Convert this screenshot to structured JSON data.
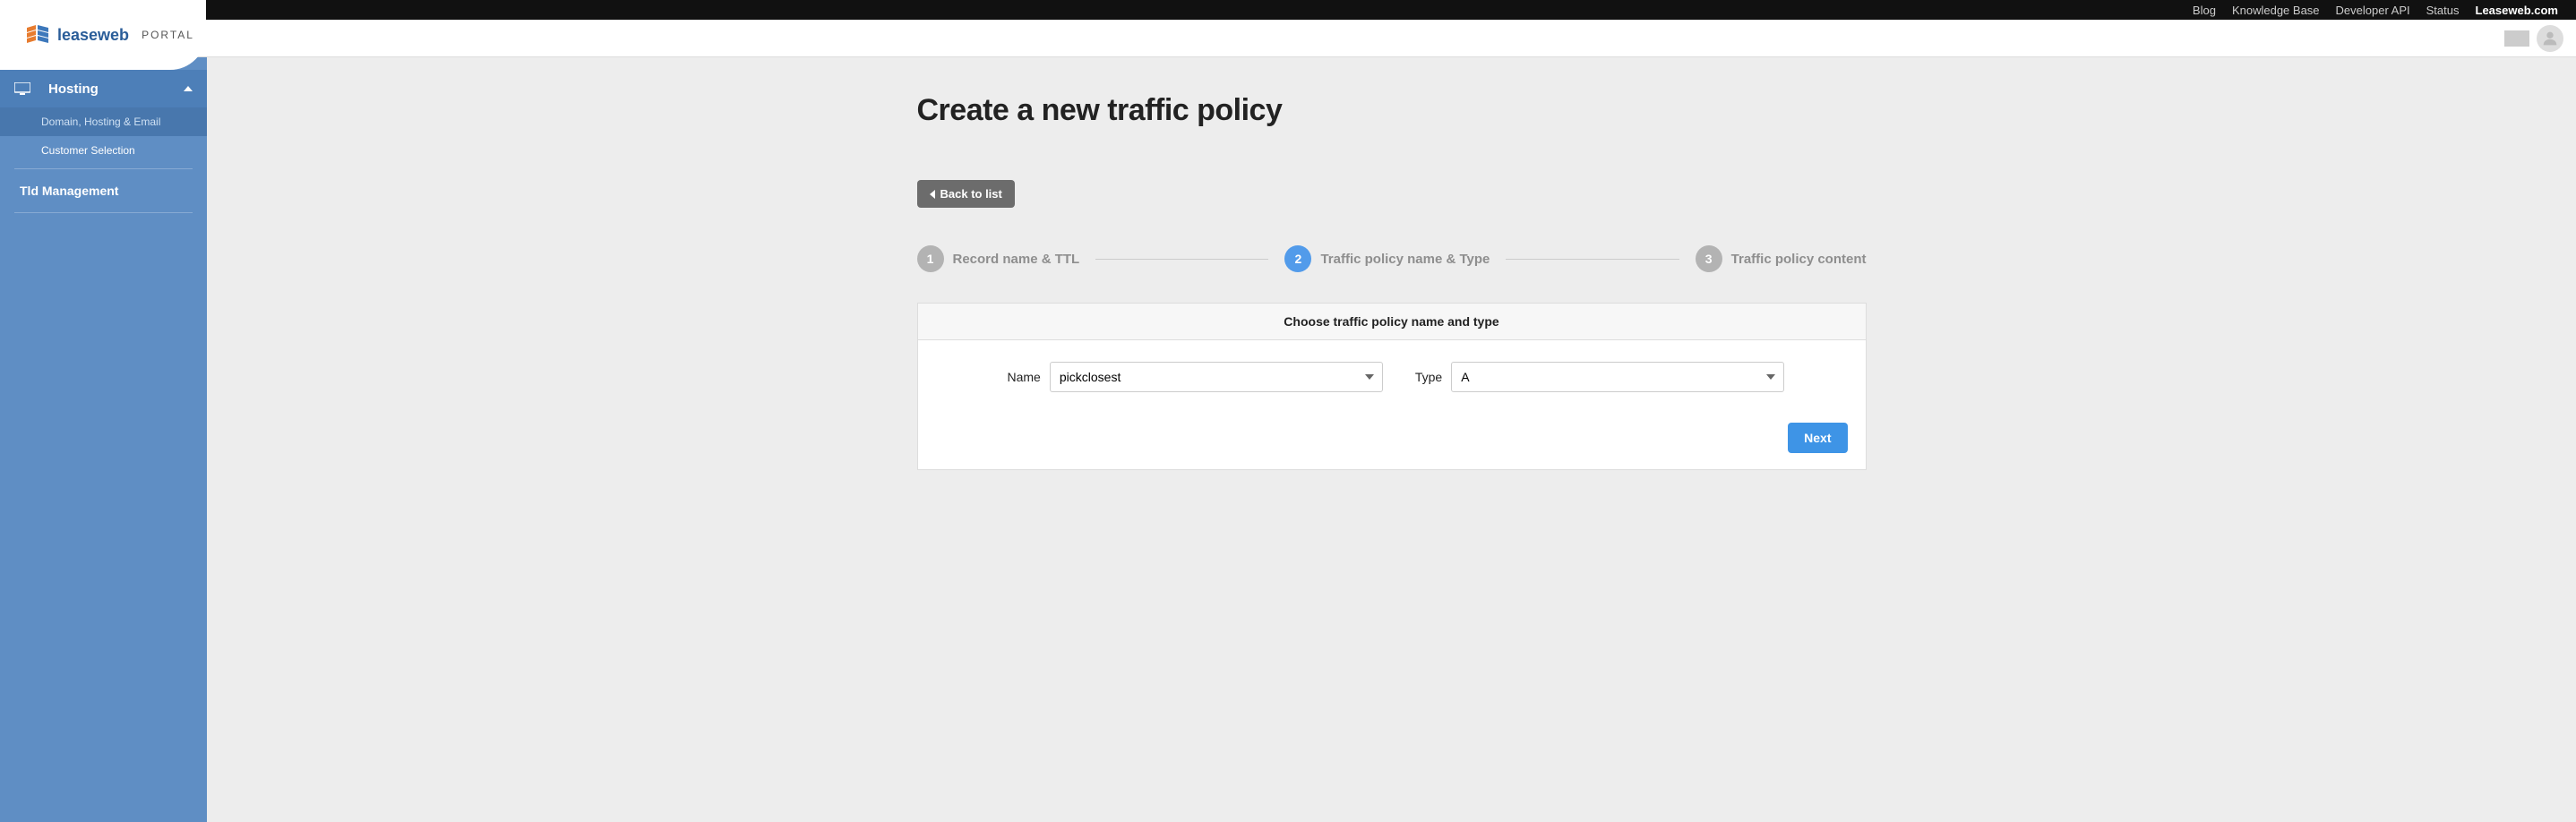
{
  "topbar": {
    "links": [
      "Blog",
      "Knowledge Base",
      "Developer API",
      "Status"
    ],
    "bold_link": "Leaseweb.com"
  },
  "logo": {
    "brand": "leaseweb",
    "portal": "PORTAL"
  },
  "sidebar": {
    "section": "Hosting",
    "items": [
      "Domain, Hosting & Email",
      "Customer Selection"
    ],
    "tld": "Tld Management"
  },
  "page": {
    "title": "Create a new traffic policy",
    "back": "Back to list"
  },
  "steps": [
    {
      "num": "1",
      "label": "Record name & TTL",
      "active": false
    },
    {
      "num": "2",
      "label": "Traffic policy name & Type",
      "active": true
    },
    {
      "num": "3",
      "label": "Traffic policy content",
      "active": false
    }
  ],
  "form": {
    "header": "Choose traffic policy name and type",
    "name_label": "Name",
    "name_value": "pickclosest",
    "type_label": "Type",
    "type_value": "A",
    "next": "Next"
  }
}
